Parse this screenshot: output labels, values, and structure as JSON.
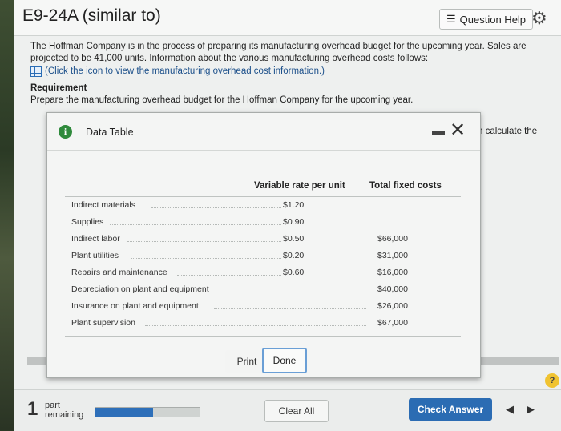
{
  "header": {
    "title": "E9-24A (similar to)",
    "question_help": "Question Help",
    "gear_icon": "gear-icon"
  },
  "problem": {
    "text": "The Hoffman Company is in the process of preparing its manufacturing overhead budget for the upcoming year. Sales are projected to be 41,000 units. Information about the various manufacturing overhead costs follows:",
    "table_link": "(Click the icon to view the manufacturing overhead cost information.)",
    "requirement_heading": "Requirement",
    "requirement_text": "Prepare the manufacturing overhead budget for the Hoffman Company for the upcoming year.",
    "right_fragment": "then calculate the"
  },
  "modal": {
    "title": "Data Table",
    "headers": {
      "variable": "Variable rate per unit",
      "fixed": "Total fixed costs"
    },
    "rows": [
      {
        "label": "Indirect materials",
        "variable": "$1.20",
        "fixed": ""
      },
      {
        "label": "Supplies",
        "variable": "$0.90",
        "fixed": ""
      },
      {
        "label": "Indirect labor",
        "variable": "$0.50",
        "fixed": "$66,000"
      },
      {
        "label": "Plant utilities",
        "variable": "$0.20",
        "fixed": "$31,000"
      },
      {
        "label": "Repairs and maintenance",
        "variable": "$0.60",
        "fixed": "$16,000"
      },
      {
        "label": "Depreciation on plant and equipment",
        "variable": "",
        "fixed": "$40,000"
      },
      {
        "label": "Insurance on plant and equipment",
        "variable": "",
        "fixed": "$26,000"
      },
      {
        "label": "Plant supervision",
        "variable": "",
        "fixed": "$67,000"
      }
    ],
    "print_label": "Print",
    "done_label": "Done"
  },
  "footer": {
    "part_number": "1",
    "part_line1": "part",
    "part_line2": "remaining",
    "progress_fraction": 0.55,
    "clear_all": "Clear All",
    "check_answer": "Check Answer",
    "help_badge": "?"
  },
  "colors": {
    "accent": "#2b6cb3",
    "info_green": "#2f8a3c",
    "help_yellow": "#f0c331"
  }
}
